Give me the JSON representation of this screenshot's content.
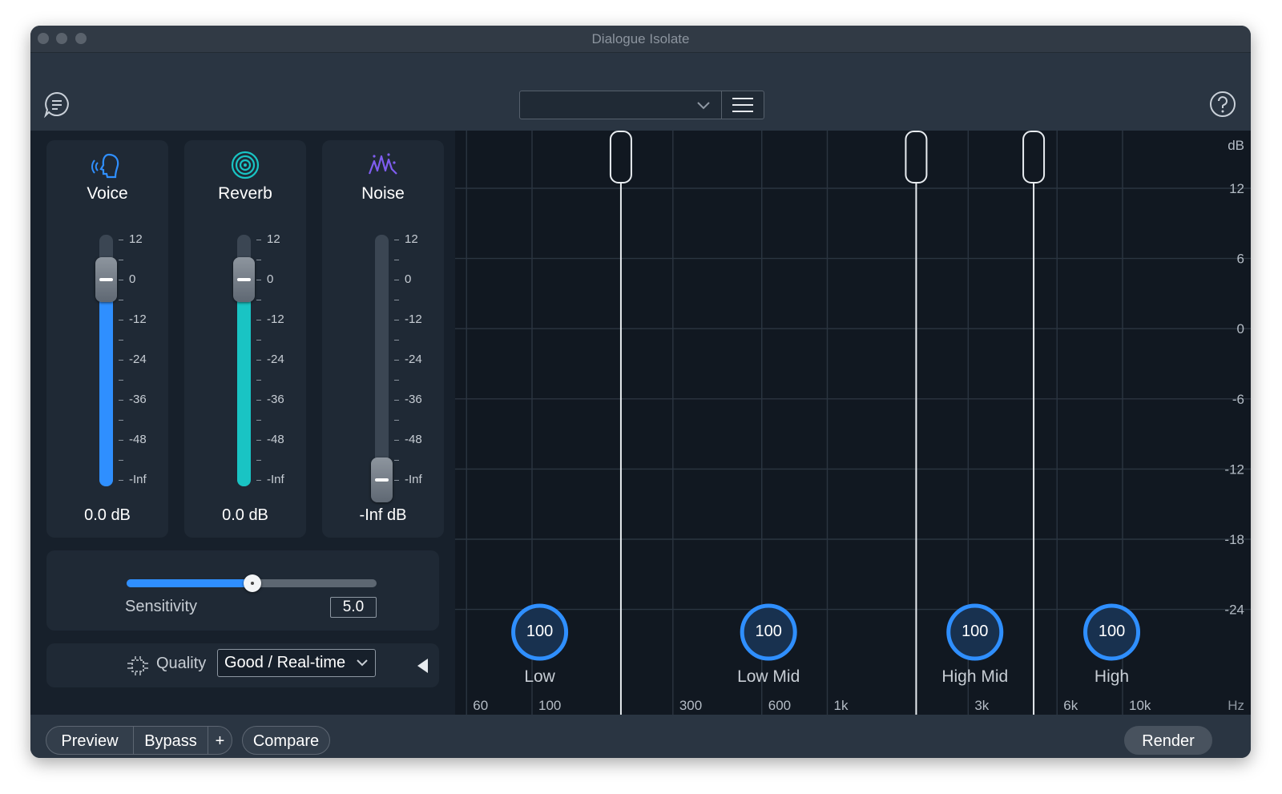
{
  "window": {
    "title": "Dialogue Isolate"
  },
  "toolbar": {
    "preset_value": "",
    "menu_icon": "hamburger-menu-icon",
    "chat_icon": "chat-bubble-icon",
    "help_icon": "question-circle-icon"
  },
  "modules": [
    {
      "label": "Voice",
      "value": "0.0 dB",
      "level_db": 0,
      "icon": "voice-head-icon",
      "color": "#2f8fff"
    },
    {
      "label": "Reverb",
      "value": "0.0 dB",
      "level_db": 0,
      "icon": "reverb-rings-icon",
      "color": "#19c4c4"
    },
    {
      "label": "Noise",
      "value": "-Inf dB",
      "level_db": "-Inf",
      "icon": "noise-waveform-icon",
      "color": "#7f5df0"
    }
  ],
  "fader_scale": [
    "12",
    "0",
    "-12",
    "-24",
    "-36",
    "-48",
    "-Inf"
  ],
  "sensitivity": {
    "label": "Sensitivity",
    "value": "5.0",
    "min": 0,
    "max": 10,
    "accent": "#2f8fff"
  },
  "quality": {
    "label": "Quality",
    "selected": "Good / Real-time",
    "icon": "chip-icon"
  },
  "graph": {
    "db_unit": "dB",
    "db_labels": [
      "12",
      "6",
      "0",
      "-6",
      "-12",
      "-18",
      "-24"
    ],
    "hz_unit": "Hz",
    "hz_labels": [
      "60",
      "100",
      "300",
      "600",
      "1k",
      "3k",
      "6k",
      "10k"
    ],
    "crossover_hz": [
      200,
      2000,
      5000
    ],
    "bands": [
      {
        "label": "Low",
        "value": "100"
      },
      {
        "label": "Low Mid",
        "value": "100"
      },
      {
        "label": "High Mid",
        "value": "100"
      },
      {
        "label": "High",
        "value": "100"
      }
    ]
  },
  "bottom": {
    "preview": "Preview",
    "bypass": "Bypass",
    "plus": "+",
    "compare": "Compare",
    "render": "Render"
  }
}
